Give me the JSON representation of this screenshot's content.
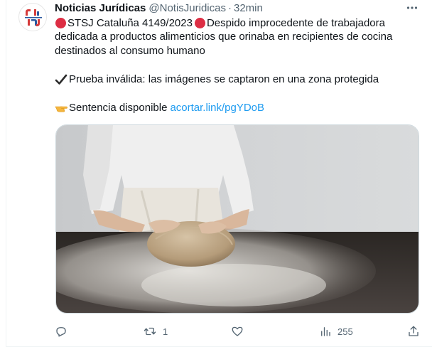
{
  "tweet": {
    "author": {
      "display_name": "Noticias Jurídicas",
      "handle": "@NotisJuridicas",
      "separator": "·",
      "time": "32min"
    },
    "more_label": "···",
    "body": {
      "line1": {
        "case_ref": "STSJ Cataluña 4149/2023",
        "text": " Despido improcedente de trabajadora"
      },
      "line2": "dedicada a productos alimenticios que orinaba en recipientes de cocina",
      "line3": "destinados al consumo humano",
      "line4": "Prueba inválida: las imágenes se captaron en una zona protegida",
      "line5": {
        "text": "Sentencia disponible",
        "link": "acortar.link/pgYDoB"
      }
    },
    "media_icon": "photo-of-person-kneading-dough-on-floured-table",
    "actions": {
      "reply_count": "",
      "retweet_count": "1",
      "like_count": "",
      "views_count": "255"
    },
    "colors": {
      "text": "#0f1419",
      "secondary": "#536471",
      "link": "#1d9bf0",
      "red_circle": "#dd2e44"
    }
  }
}
